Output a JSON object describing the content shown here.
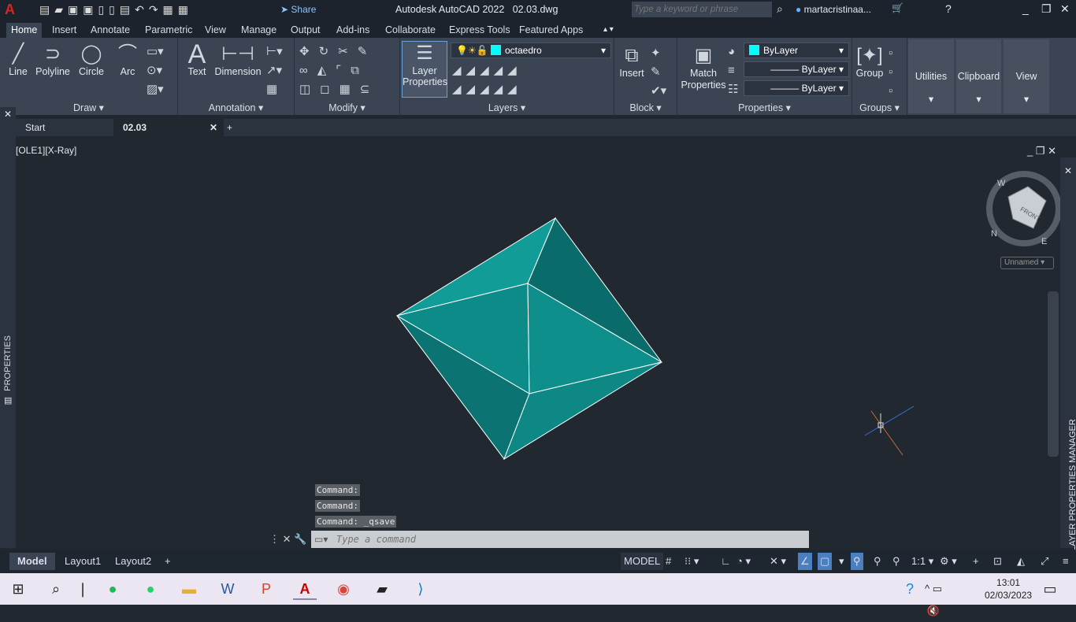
{
  "app": {
    "title": "Autodesk AutoCAD 2022",
    "file": "02.03.dwg",
    "search_placeholder": "Type a keyword or phrase",
    "user": "martacristinaa...",
    "share": "Share"
  },
  "ribbon_tabs": [
    "Home",
    "Insert",
    "Annotate",
    "Parametric",
    "View",
    "Manage",
    "Output",
    "Add-ins",
    "Collaborate",
    "Express Tools",
    "Featured Apps"
  ],
  "draw": {
    "title": "Draw",
    "tools": [
      "Line",
      "Polyline",
      "Circle",
      "Arc"
    ]
  },
  "annotation": {
    "title": "Annotation",
    "tools": [
      "Text",
      "Dimension"
    ]
  },
  "modify": {
    "title": "Modify"
  },
  "layers": {
    "title": "Layers",
    "layer_properties": "Layer\nProperties",
    "current_layer": "octaedro",
    "layer_color": "#00ffff"
  },
  "block": {
    "title": "Block",
    "insert": "Insert"
  },
  "properties": {
    "title": "Properties",
    "match": "Match\nProperties",
    "color": "ByLayer",
    "linetype": "ByLayer",
    "lineweight": "ByLayer"
  },
  "groups": {
    "title": "Groups",
    "group": "Group"
  },
  "big_panels": [
    "Utilities",
    "Clipboard",
    "View"
  ],
  "file_tabs": [
    "Start",
    "02.03"
  ],
  "viewport": {
    "label": "[OLE1][X-Ray]",
    "viewcube_face": "FRONT",
    "compass": [
      "W",
      "N",
      "E"
    ],
    "named_view": "Unnamed"
  },
  "side_palettes": {
    "left": "PROPERTIES",
    "right": "LAYER PROPERTIES MANAGER"
  },
  "command_history": [
    "Command:",
    "Command:",
    "Command: _qsave"
  ],
  "command_placeholder": "Type a command",
  "layout_tabs": [
    "Model",
    "Layout1",
    "Layout2"
  ],
  "status": {
    "model": "MODEL",
    "scale": "1:1"
  },
  "clock": {
    "time": "13:01",
    "date": "02/03/2023"
  },
  "colors": {
    "solid": "#0e8f8c",
    "background": "#212830",
    "ribbon": "#3b4453"
  }
}
